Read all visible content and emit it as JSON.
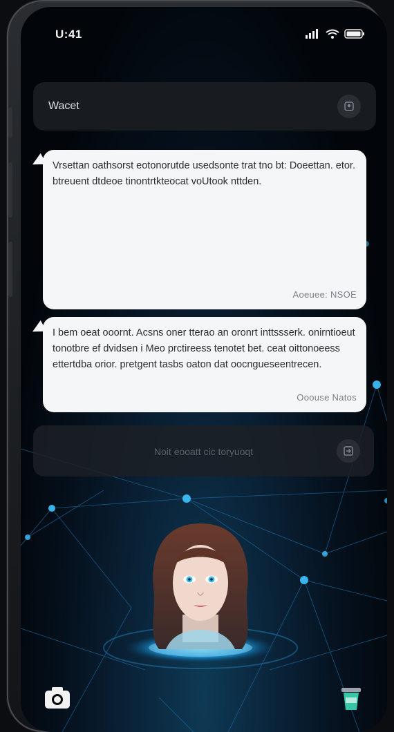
{
  "status_bar": {
    "time": "U:41"
  },
  "search": {
    "label": "Wacet"
  },
  "messages": [
    {
      "text": "Vrsettan oathsorst eotonorutde usedsonte trat tno bt: Doeettan. etor. btreuent dtdeoe tinontrtkteocat voUtook nttden.",
      "meta": "Aoeuee: NSOE"
    },
    {
      "text": "I bem oeat ooornt. Acsns oner tterao an oronrt inttssserk. onirntioeut tonotbre ef dvidsen i Meo prctireess tenotet bet. ceat oittonoeess ettertdba orior. pretgent tasbs oaton dat oocngueseentrecen.",
      "meta": "Ooouse Natos"
    }
  ],
  "input": {
    "placeholder": "Noit eooatt cic toryuoqt"
  },
  "colors": {
    "bubble": "#f5f6f7",
    "accent_glow": "#2fb6ff",
    "background": "#020509"
  },
  "icons": [
    "signal-icon",
    "wifi-icon",
    "battery-icon",
    "profile-icon",
    "send-icon",
    "camera-icon",
    "cup-icon"
  ]
}
